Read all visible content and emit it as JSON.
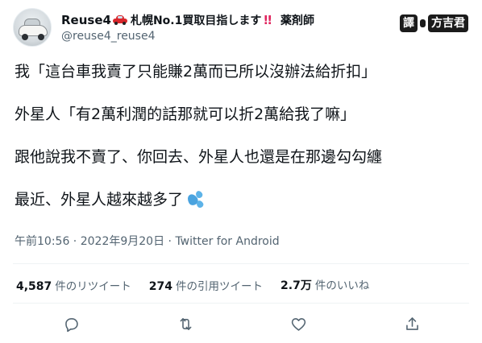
{
  "author": {
    "display_name": "Reuse4",
    "bio_name": "札幌No.1買取目指します",
    "bio_bang": "!!",
    "bio_job": "薬剤師",
    "handle": "@reuse4_reuse4",
    "car_icon": "red-car-emoji"
  },
  "watermark": {
    "left_char": "譯",
    "right_text": "方吉君"
  },
  "tweet": {
    "lines": [
      "我「這台車我賣了只能賺2萬而已所以沒辦法給折扣」",
      "外星人「有2萬利潤的話那就可以折2萬給我了嘛」",
      "跟他說我不賣了、你回去、外星人也還是在那邊勾勾纏",
      "最近、外星人越來越多了"
    ],
    "trailing_emoji": "sweat-droplets-emoji"
  },
  "meta": {
    "time": "午前10:56",
    "sep1": " · ",
    "date": "2022年9月20日",
    "sep2": " · ",
    "source": "Twitter for Android"
  },
  "stats": {
    "retweets": {
      "count": "4,587",
      "label": "件のリツイート"
    },
    "quotes": {
      "count": "274",
      "label": "件の引用ツイート"
    },
    "likes": {
      "count": "2.7万",
      "label": "件のいいね"
    }
  },
  "colors": {
    "text": "#0f1419",
    "muted": "#536471",
    "divider": "#eff3f4",
    "bang": "#e0245e",
    "sweat": "#4aa3df"
  },
  "actions": [
    "reply-icon",
    "retweet-icon",
    "like-icon",
    "share-icon"
  ]
}
